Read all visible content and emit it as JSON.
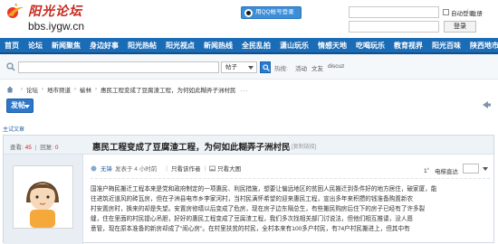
{
  "header": {
    "logo_title": "阳光论坛",
    "logo_url": "bbs.iygw.cn",
    "qq_button": "用QQ帐号登录",
    "auto_login": "自动登录",
    "separator": "|",
    "register": "注册",
    "login_button": "登录"
  },
  "nav": {
    "items": [
      "首页",
      "论坛",
      "新闻聚焦",
      "身边好事",
      "阳光热帖",
      "阳光视点",
      "新闻热线",
      "全民乱拍",
      "潇山玩乐",
      "情感天地",
      "吃喝玩乐",
      "教育视界",
      "阳光百味",
      "陕西地市"
    ]
  },
  "search": {
    "type_label": "帖子",
    "hot_label": "热搜:",
    "hot_items": [
      "活动",
      "文友",
      "discuz"
    ]
  },
  "breadcrumb": {
    "items": [
      "论坛",
      "地市频道",
      "榆林",
      "惠民工程变成了豆腐渣工程，为何如此糊弄子洲村民"
    ],
    "more": "..."
  },
  "toolbar": {
    "post_button": "发帖"
  },
  "section_label": "主试文章",
  "thread": {
    "stats": {
      "views_label": "查看:",
      "views": "45",
      "replies_label": "回复:",
      "replies": "0"
    },
    "title": "惠民工程变成了豆腐渣工程，为何如此糊弄子洲村民",
    "copy_link": "[复制链接]",
    "post": {
      "author": "无锋",
      "posted_time": "发表于 4 小时前",
      "only_author": "只看该作者",
      "view_large": "只看大图",
      "floor": "1",
      "floor_suffix": "#",
      "jump_label": "电梯直达",
      "body_lines": [
        "国准户梅民搬迁工程本来是党和政府制定的一项惠民、利民措施，想要让偏远地区的贫困人民搬迁到条件好的地方居住，破家厦，能",
        "往进筑近道风的砖瓦房，但在子洲县电市乡李家河村，当村民满怀希望的迎来惠民工程，宣出多年来积攒的钱准备购置新农",
        "村安置房时，换来的却是失望。安置房修缮以后变成了危房，现在房子边东隔总生，有些搬民购房后住下的房子已经有了许多裂",
        "缝，住在里面的村民提心吊胆，好好的惠民工程变成了豆腐渣工程，我们多次找相关部门讨说法，但他们相互推诿，没人愿",
        "意管，现在原本准备的新房却成了\"闹心房\"。在村里扶贫的村民，全村本来有100多户村民，有74户村民搬进上，但其中有"
      ]
    }
  },
  "colors": {
    "nav_bg": "#1b6cb6",
    "logo_red": "#c8281e",
    "link_blue": "#2a62a6",
    "button_blue": "#2c77c9"
  }
}
